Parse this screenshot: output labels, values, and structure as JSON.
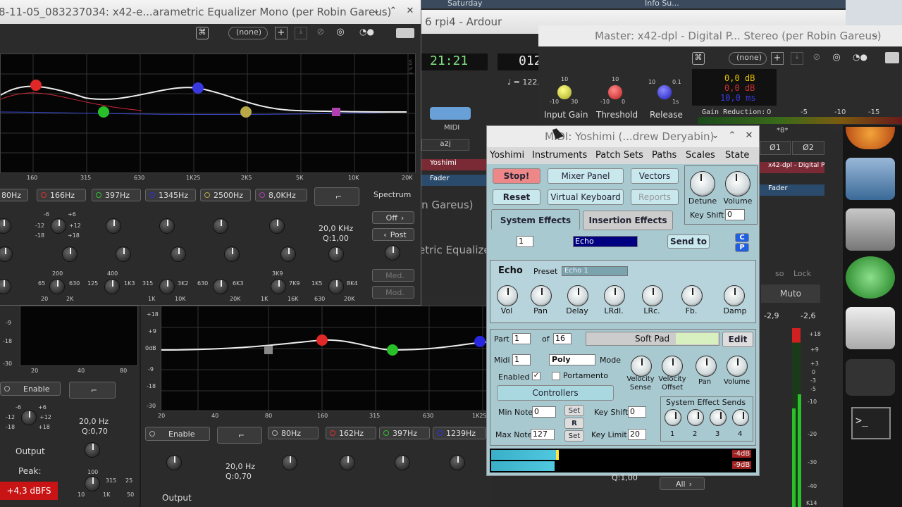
{
  "eq_mono": {
    "title": "8-11-05_083237034: x42-e...arametric Equalizer Mono (per Robin Gareus)",
    "preset": "(none)",
    "freq_labels": [
      "160",
      "315",
      "630",
      "1K25",
      "2K5",
      "5K",
      "10K",
      "20K"
    ],
    "bands": [
      "80Hz",
      "166Hz",
      "397Hz",
      "1345Hz",
      "2500Hz",
      "8,0KHz"
    ],
    "bw": "20,0 KHz",
    "q": "Q:1,00",
    "spectrum_label": "Spectrum",
    "off_label": "Off",
    "post_label": "Post",
    "med_label": "Med.",
    "mod_label": "Mod.",
    "gain_scale": [
      "-6",
      "+6",
      "-12",
      "+12",
      "-18",
      "+18"
    ],
    "freq_scale": [
      "200",
      "400",
      "65",
      "630",
      "125",
      "1K3",
      "315",
      "3K2",
      "630",
      "6K3",
      "3K9",
      "7K9",
      "1K5",
      "8K4",
      "20",
      "2K",
      "1K",
      "10K",
      "20K",
      "1K",
      "16K",
      "630",
      "20K"
    ],
    "version": "v0.5.7"
  },
  "ardour": {
    "title": "6 rpi4 - Ardour",
    "clock1": "21:21",
    "clock2": "012",
    "tempo": "♩ = 122,0",
    "midi_label": "MIDI",
    "a2j": "a2j",
    "yoshimi_strip": "Yoshimi",
    "fader_label": "Fader",
    "robin": "in Gareus)",
    "eq_label": "etric Equalize",
    "top_right": "Info Su...",
    "top_left": "Saturday"
  },
  "master": {
    "title": "Master: x42-dpl - Digital P... Stereo (per Robin Gareus)",
    "preset": "(none)",
    "input_gain_label": "Input Gain",
    "threshold_label": "Threshold",
    "release_label": "Release",
    "db1": "0,0 dB",
    "db2": "0,0 dB",
    "ms": "10,0 ms",
    "gr_label": "Gain Reduction:",
    "gr_ticks": [
      "0",
      "-5",
      "-10",
      "-15"
    ],
    "knob_scale": [
      "10",
      "-10",
      "30",
      "10",
      "-10",
      "0",
      "10",
      "0.1",
      "1s"
    ],
    "strip_label": "x42-dpl - Digital Pe",
    "strip_fader": "Fader",
    "btn1": "Ø1",
    "btn2": "Ø2",
    "slot": "*8*",
    "lock": "Lock",
    "muto": "Muto",
    "so": "so",
    "m29": "-2,9",
    "m26": "-2,6",
    "meter_scale": [
      "+18",
      "+9",
      "+3",
      "0",
      "-3",
      "-5",
      "-10",
      "-20",
      "-30",
      "-40"
    ],
    "k14": "K14"
  },
  "yoshimi": {
    "title": "MIDI: Yoshimi (...drew Deryabin)",
    "menu": [
      "Yoshimi",
      "Instruments",
      "Patch Sets",
      "Paths",
      "Scales",
      "State"
    ],
    "stop": "Stop!",
    "reset": "Reset",
    "mixer": "Mixer Panel",
    "vkbd": "Virtual Keyboard",
    "vectors": "Vectors",
    "reports": "Reports",
    "detune": "Detune",
    "volume": "Volume",
    "keyshift_label": "Key Shift",
    "keyshift_val": "0",
    "tab_sys": "System Effects",
    "tab_ins": "Insertion Effects",
    "effect_num": "1",
    "effect_sel": "Echo",
    "send_to": "Send to",
    "c": "C",
    "p": "P",
    "echo": "Echo",
    "preset_label": "Preset",
    "preset_val": "Echo 1",
    "echo_knobs": [
      "Vol",
      "Pan",
      "Delay",
      "LRdl.",
      "LRc.",
      "Fb.",
      "Damp"
    ],
    "part_label": "Part",
    "part_val": "1",
    "of_label": "of",
    "of_val": "16",
    "soft_pad": "Soft Pad",
    "edit": "Edit",
    "midi_label": "Midi",
    "midi_val": "1",
    "poly": "Poly",
    "mode": "Mode",
    "enabled": "Enabled",
    "portamento": "Portamento",
    "vel_sense": "Velocity Sense",
    "vel_offset": "Velocity Offset",
    "pan": "Pan",
    "vol": "Volume",
    "controllers": "Controllers",
    "min_note": "Min Note",
    "min_val": "0",
    "max_note": "Max Note",
    "max_val": "127",
    "set": "Set",
    "r": "R",
    "key_shift": "Key Shift",
    "ks_val": "0",
    "key_limit": "Key Limit",
    "kl_val": "20",
    "sys_sends": "System Effect Sends",
    "sends": [
      "1",
      "2",
      "3",
      "4"
    ],
    "db_hi": "-4dB",
    "db_lo": "-9dB"
  },
  "eq_lower": {
    "enable": "Enable",
    "bands": [
      "80Hz",
      "162Hz",
      "397Hz",
      "1239Hz"
    ],
    "bw": "20,0 Hz",
    "q": "Q:0,70",
    "output": "Output",
    "freq_labels": [
      "20",
      "40",
      "80",
      "160",
      "315",
      "630",
      "1K25"
    ],
    "db_labels": [
      "+18",
      "+9",
      "0dB",
      "-9",
      "-18",
      "-30"
    ],
    "q2": "Q:1,00",
    "all": "All"
  },
  "eq_left": {
    "enable": "Enable",
    "bw": "20,0 Hz",
    "q": "Q:0,70",
    "output": "Output",
    "peak": "Peak:",
    "peak_val": "+4,3 dBFS",
    "db_labels": [
      "-9",
      "-18",
      "-30"
    ],
    "x_labels": [
      "20",
      "40",
      "80"
    ],
    "scale": [
      "-6",
      "+6",
      "-12",
      "+12",
      "-18",
      "+18",
      "100",
      "315",
      "25",
      "10",
      "1K",
      "50"
    ]
  }
}
